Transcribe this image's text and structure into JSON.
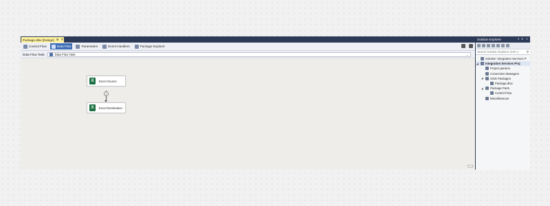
{
  "document_tab": {
    "title": "Package.dtsx [Design]",
    "pin": "⊕",
    "close": "✕"
  },
  "design_tabs": [
    {
      "label": "Control Flow",
      "active": false
    },
    {
      "label": "Data Flow",
      "active": true
    },
    {
      "label": "Parameters",
      "active": false
    },
    {
      "label": "Event Handlers",
      "active": false
    },
    {
      "label": "Package Explorer",
      "active": false
    }
  ],
  "task_bar": {
    "label": "Data Flow Task:",
    "selected": "Data Flow Task",
    "chevron": "⌄"
  },
  "canvas": {
    "components": [
      {
        "label": "Excel Source",
        "icon": "excel-icon",
        "icon_text": "X"
      },
      {
        "label": "Excel Destination",
        "icon": "excel-icon",
        "icon_text": "X"
      }
    ],
    "connector_node": "1"
  },
  "solution_explorer": {
    "title": "Solution Explorer",
    "title_buttons": "▾ ⊕ ✕",
    "search_placeholder": "Search Solution Explorer (Ctrl+;)",
    "search_icon": "⚲",
    "tree": [
      {
        "label": "Solution 'Integration Services P",
        "level": 0,
        "expander": "",
        "selected": false
      },
      {
        "label": "Integration Services Proj",
        "level": 0,
        "expander": "◢",
        "selected": true
      },
      {
        "label": "Project.params",
        "level": 1,
        "expander": "",
        "selected": false
      },
      {
        "label": "Connection Managers",
        "level": 1,
        "expander": "",
        "selected": false
      },
      {
        "label": "SSIS Packages",
        "level": 1,
        "expander": "◢",
        "selected": false
      },
      {
        "label": "Package.dtsx",
        "level": 2,
        "expander": "",
        "selected": false
      },
      {
        "label": "Package Parts",
        "level": 1,
        "expander": "◢",
        "selected": false
      },
      {
        "label": "Control Flow",
        "level": 2,
        "expander": "",
        "selected": false
      },
      {
        "label": "Miscellaneous",
        "level": 1,
        "expander": "",
        "selected": false
      }
    ]
  },
  "colors": {
    "accent": "#3e6db5",
    "frame": "#2d3a57",
    "doc_tab": "#fff29d",
    "excel": "#1e7145"
  }
}
